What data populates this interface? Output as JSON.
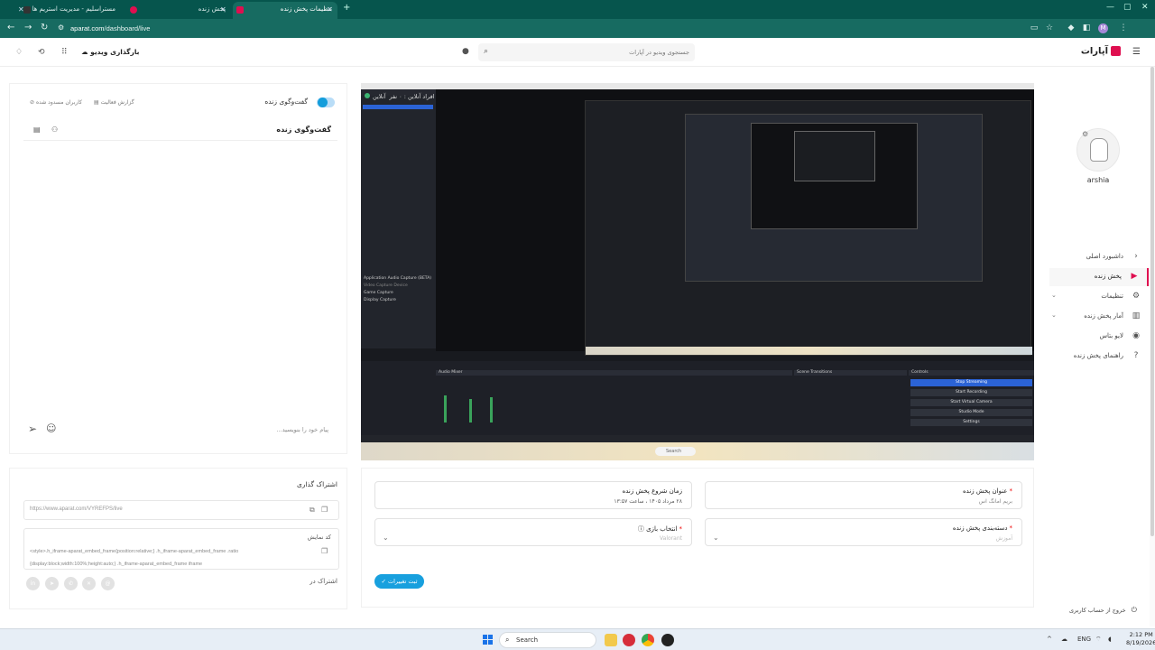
{
  "browser": {
    "tabs": [
      {
        "title": "مستراسلیم - مدیریت استریم ها",
        "active": false
      },
      {
        "title": "پخش زنده",
        "active": false
      },
      {
        "title": "تنظیمات پخش زنده",
        "active": true
      }
    ],
    "url_host": "aparat.com",
    "url_path": "/dashboard/live",
    "profile_initial": "M"
  },
  "header": {
    "logo_text": "آپارات",
    "search_placeholder": "جستجوی ویدیو در آپارات",
    "upload_label": "بارگذاری ویدیو"
  },
  "chat": {
    "toggle_label": "گفت‌وگوی زنده",
    "tab_reports": "گزارش فعالیت",
    "tab_blocked": "کاربران مسدود شده",
    "title": "گفت‌وگوی زنده",
    "input_placeholder": "پیام خود را بنویسید..."
  },
  "share": {
    "title": "اشتراک گذاری",
    "link": "https://www.aparat.com/VYREFPS/live",
    "embed_label": "کد نمایش",
    "embed_code_line1": "<style>.h_iframe-aparat_embed_frame{position:relative;} .h_iframe-aparat_embed_frame .ratio",
    "embed_code_line2": "{display:block;width:100%;height:auto;} .h_iframe-aparat_embed_frame iframe",
    "share_in_label": "اشتراک در",
    "social_icons": [
      "linkedin-icon",
      "telegram-icon",
      "whatsapp-icon",
      "x-icon",
      "threads-icon"
    ]
  },
  "preview": {
    "live_label": "آنلاین",
    "viewers_label": "افراد آنلاین : ۰ نفر",
    "obs_sources": [
      "Application Audio Capture (BETA)",
      "Video Capture Device",
      "Game Capture",
      "Display Capture"
    ],
    "obs_controls": [
      "Stop Streaming",
      "Start Recording",
      "Start Virtual Camera",
      "Studio Mode",
      "Settings"
    ],
    "obs_panels": [
      "Audio Mixer",
      "Scene Transitions",
      "Controls"
    ],
    "obs_search": "Search"
  },
  "form": {
    "title_label": "عنوان پخش زنده",
    "title_value": "بریم امانگ اس",
    "start_label": "زمان شروع پخش زنده",
    "start_value": "۲۸ مرداد ۱۴۰۵ ، ساعت ۱۳:۵۷",
    "category_label": "دسته‌بندی پخش زنده",
    "category_value": "آموزش",
    "game_label": "انتخاب بازی",
    "game_value": "Valorant",
    "submit_label": "ثبت تغییرات"
  },
  "sidebar": {
    "username": "arshia",
    "items": [
      {
        "label": "داشبورد اصلی",
        "icon": "dashboard-icon",
        "chevron": true,
        "active": false
      },
      {
        "label": "پخش زنده",
        "icon": "live-icon",
        "chevron": false,
        "active": true
      },
      {
        "label": "تنظیمات",
        "icon": "gear-icon",
        "chevron": true,
        "active": false
      },
      {
        "label": "آمار پخش زنده",
        "icon": "chart-icon",
        "chevron": true,
        "active": false
      },
      {
        "label": "لایو بتاس",
        "icon": "broadcast-icon",
        "chevron": false,
        "active": false
      },
      {
        "label": "راهنمای پخش زنده",
        "icon": "help-icon",
        "chevron": false,
        "active": false
      }
    ],
    "logout_label": "خروج از حساب کاربری"
  },
  "taskbar": {
    "search_label": "Search",
    "lang": "ENG",
    "time": "2:12 PM",
    "date": "8/19/2026"
  },
  "colors": {
    "brand": "#df0f50",
    "accent": "#18a0de",
    "browser_frame": "#06554d"
  }
}
